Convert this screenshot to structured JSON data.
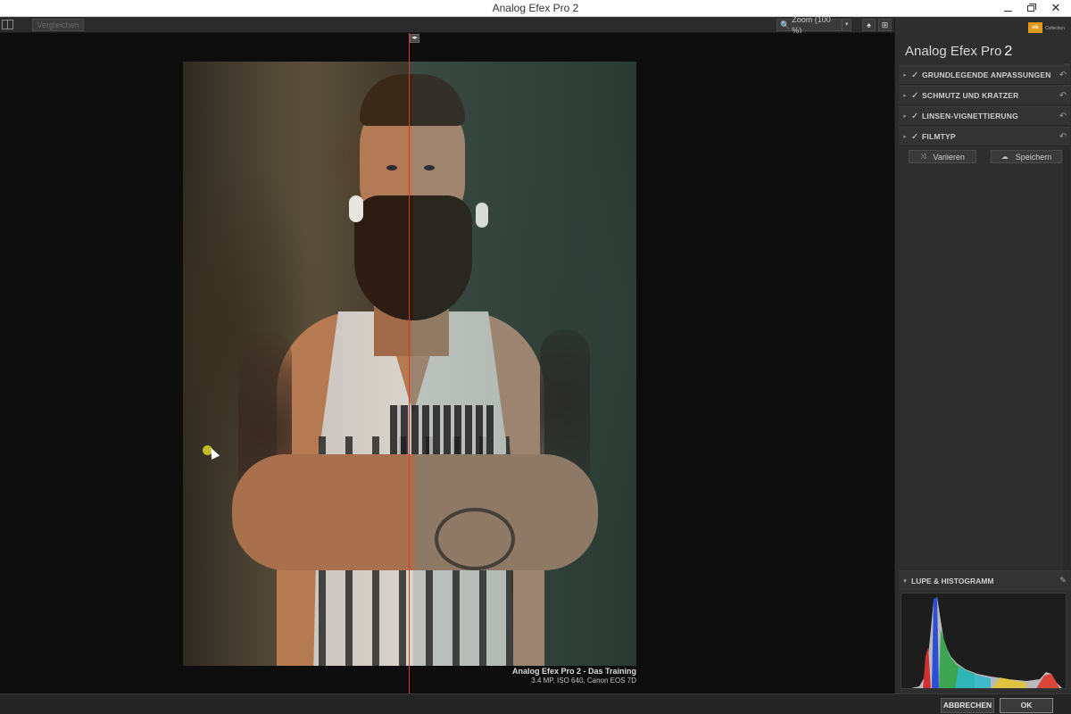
{
  "window": {
    "title": "Analog Efex Pro 2",
    "controls": {
      "minimize": "–",
      "maximize": "",
      "close": "✕"
    }
  },
  "toolbar": {
    "compare_label": "Vergleichen",
    "zoom_label": "Zoom (100 %)",
    "zoom_arrow": "▾",
    "loupe_icon": "♠",
    "fullscreen_icon": "⊞"
  },
  "canvas": {
    "split_handle": "◂▸",
    "caption_title": "Analog Efex Pro 2 - Das Training",
    "caption_meta": "3.4 MP, ISO 640, Canon EOS 7D"
  },
  "panel": {
    "brand_logo": "nik",
    "brand_sub": "Collection",
    "app_name": "Analog Efex Pro",
    "app_version": "2",
    "sections": [
      {
        "label": "GRUNDLEGENDE ANPASSUNGEN",
        "checked": "✓",
        "expand": "▸",
        "undo": "↶"
      },
      {
        "label": "SCHMUTZ UND KRATZER",
        "checked": "✓",
        "expand": "▸",
        "undo": "↶"
      },
      {
        "label": "LINSEN-VIGNETTIERUNG",
        "checked": "✓",
        "expand": "▸",
        "undo": "↶"
      },
      {
        "label": "FILMTYP",
        "checked": "✓",
        "expand": "▸",
        "undo": "↶"
      }
    ],
    "vary_label": "Variieren",
    "vary_icon": "⤨",
    "save_label": "Speichern",
    "save_icon": "☁",
    "loupe": {
      "label": "LUPE & HISTOGRAMM",
      "expand": "▾",
      "pin": "✎"
    }
  },
  "footer": {
    "cancel_label": "ABBRECHEN",
    "ok_label": "OK"
  },
  "colors": {
    "accent_split_line": "#d93a2e",
    "brand_orange": "#e29a1e",
    "panel_bg": "#2e2e2e"
  }
}
